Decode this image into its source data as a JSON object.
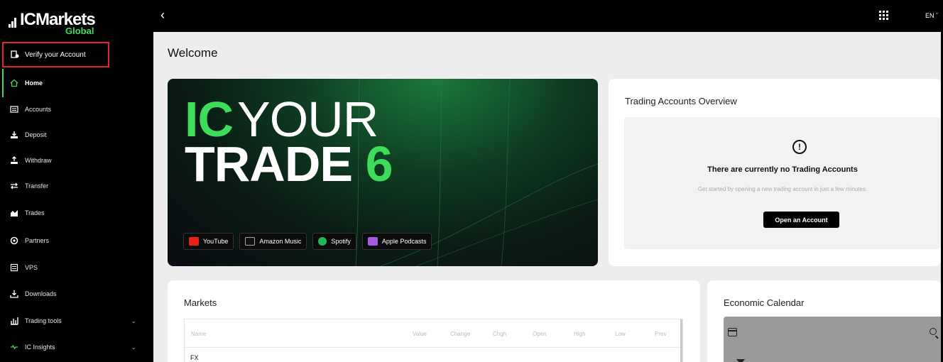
{
  "brand": {
    "name_ic": "IC",
    "name_markets": "Markets",
    "sub": "Global"
  },
  "sidebar": {
    "verify_label": "Verify your Account",
    "items": [
      {
        "label": "Home",
        "icon": "home-icon"
      },
      {
        "label": "Accounts",
        "icon": "accounts-icon"
      },
      {
        "label": "Deposit",
        "icon": "deposit-icon"
      },
      {
        "label": "Withdraw",
        "icon": "withdraw-icon"
      },
      {
        "label": "Transfer",
        "icon": "transfer-icon"
      },
      {
        "label": "Trades",
        "icon": "trades-icon"
      },
      {
        "label": "Partners",
        "icon": "partners-icon"
      },
      {
        "label": "VPS",
        "icon": "vps-icon"
      },
      {
        "label": "Downloads",
        "icon": "downloads-icon"
      },
      {
        "label": "Trading tools",
        "icon": "trading-tools-icon"
      },
      {
        "label": "IC Insights",
        "icon": "ic-insights-icon"
      }
    ]
  },
  "topbar": {
    "lang": "EN"
  },
  "main": {
    "welcome": "Welcome",
    "banner": {
      "ic": "IC",
      "your": "YOUR",
      "trade": "TRADE",
      "six": "6"
    },
    "platforms": [
      "YouTube",
      "Amazon Music",
      "Spotify",
      "Apple Podcasts"
    ],
    "trading_overview": {
      "title": "Trading Accounts Overview",
      "message": "There are currently no Trading Accounts",
      "sub": "Get started by opening a new trading account in just a few minutes.",
      "button": "Open an Account"
    },
    "markets": {
      "title": "Markets",
      "columns": [
        "Name",
        "Value",
        "Change",
        "Chgh",
        "Open",
        "High",
        "Low",
        "Prev"
      ],
      "group": "FX"
    },
    "economic_calendar": {
      "title": "Economic Calendar"
    }
  },
  "colors": {
    "accent": "#3ddc5a",
    "verify_border": "#e3232c"
  }
}
